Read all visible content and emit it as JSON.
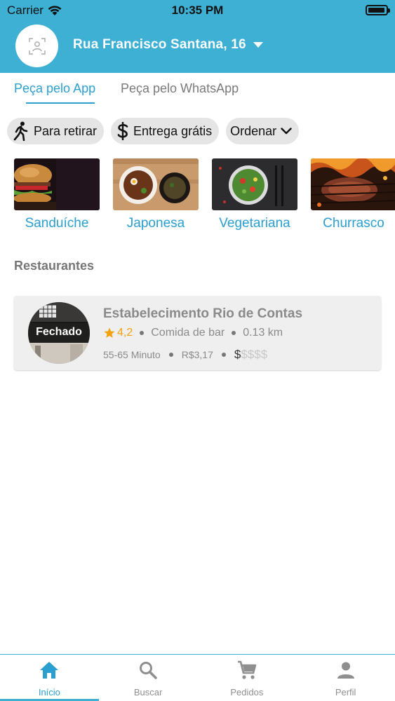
{
  "status_bar": {
    "carrier": "Carrier",
    "time": "10:35 PM",
    "battery_level": 0.95
  },
  "header": {
    "address": "Rua Francisco Santana, 16"
  },
  "tabs": [
    {
      "label": "Peça pelo App",
      "active": true
    },
    {
      "label": "Peça pelo WhatsApp",
      "active": false
    }
  ],
  "filters": [
    {
      "label": "Para retirar",
      "icon": "walking-person-icon"
    },
    {
      "label": "Entrega grátis",
      "icon": "dollar-icon"
    },
    {
      "label": "Ordenar",
      "icon": "chevron-down-icon"
    }
  ],
  "categories": [
    {
      "label": "Sanduíche"
    },
    {
      "label": "Japonesa"
    },
    {
      "label": "Vegetariana"
    },
    {
      "label": "Churrasco"
    }
  ],
  "restaurants_section": {
    "title": "Restaurantes"
  },
  "restaurants": [
    {
      "name": "Estabelecimento Rio de Contas",
      "status": "Fechado",
      "rating": "4,2",
      "category": "Comida de bar",
      "distance": "0.13 km",
      "time": "55-65 Minuto",
      "fee": "R$3,17",
      "price_on": "$",
      "price_off": "$$$$"
    }
  ],
  "bottom_nav": [
    {
      "label": "Início",
      "icon": "home-icon",
      "active": true
    },
    {
      "label": "Buscar",
      "icon": "search-icon",
      "active": false
    },
    {
      "label": "Pedidos",
      "icon": "cart-icon",
      "active": false
    },
    {
      "label": "Perfil",
      "icon": "person-icon",
      "active": false
    }
  ],
  "colors": {
    "primary": "#3db0d4",
    "accent_text": "#2b9fd0",
    "rating": "#f3a111"
  }
}
